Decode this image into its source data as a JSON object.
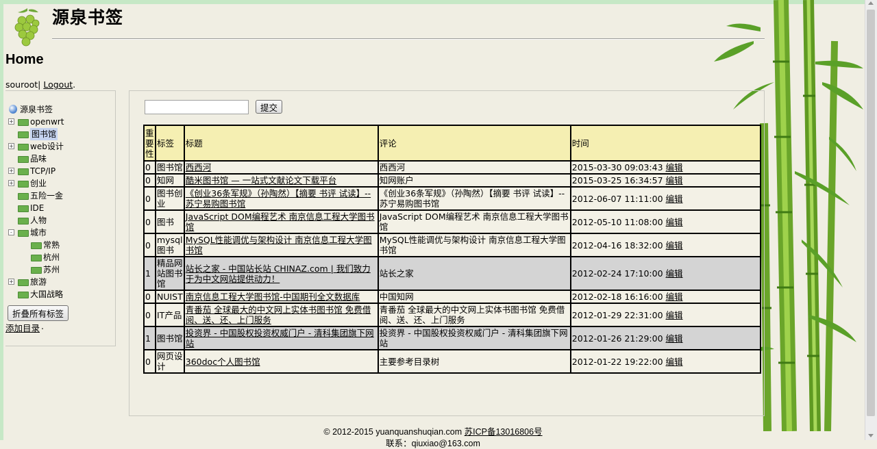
{
  "site": {
    "title": "源泉书签",
    "page_title": "Home"
  },
  "user": {
    "name": "souroot",
    "sep": "|",
    "logout_label": "Logout",
    "suffix": "."
  },
  "sidebar": {
    "root_label": "源泉书签",
    "items": [
      {
        "label": "openwrt",
        "toggle": "+"
      },
      {
        "label": "图书馆",
        "toggle": "",
        "selected": true
      },
      {
        "label": "web设计",
        "toggle": "+"
      },
      {
        "label": "品味",
        "toggle": ""
      },
      {
        "label": "TCP/IP",
        "toggle": "+"
      },
      {
        "label": "创业",
        "toggle": "+"
      },
      {
        "label": "五险一金",
        "toggle": ""
      },
      {
        "label": "IDE",
        "toggle": ""
      },
      {
        "label": "人物",
        "toggle": ""
      },
      {
        "label": "城市",
        "toggle": "-"
      },
      {
        "label": "常熟",
        "toggle": "",
        "child": true
      },
      {
        "label": "杭州",
        "toggle": "",
        "child": true
      },
      {
        "label": "苏州",
        "toggle": "",
        "child": true
      },
      {
        "label": "旅游",
        "toggle": "+"
      },
      {
        "label": "大国战略",
        "toggle": ""
      }
    ],
    "collapse_button": "折叠所有标签",
    "add_directory": "添加目录",
    "add_directory_suffix": "."
  },
  "search": {
    "placeholder": "",
    "value": "",
    "submit_label": "提交"
  },
  "table": {
    "headers": {
      "importance": "重要性",
      "tag": "标签",
      "title": "标题",
      "comment": "评论",
      "time": "时间"
    },
    "edit_label": "编辑",
    "rows": [
      {
        "importance": "0",
        "tag": "图书馆",
        "title": "西西河",
        "comment": "西西河",
        "time": "2015-03-30 09:03:43",
        "highlight": false
      },
      {
        "importance": "0",
        "tag": "知网",
        "title": "酷米图书馆 — 一站式文献论文下载平台",
        "comment": "知网账户",
        "time": "2015-03-25 16:34:57",
        "highlight": false
      },
      {
        "importance": "0",
        "tag": "图书创业",
        "title": "《创业36条军规》（孙陶然）【摘要 书评 试读】--苏宁易购图书馆",
        "comment": "《创业36条军规》（孙陶然）【摘要 书评 试读】--苏宁易购图书馆",
        "time": "2012-06-07 11:11:00",
        "highlight": false
      },
      {
        "importance": "0",
        "tag": "图书",
        "title": "JavaScript DOM编程艺术 南京信息工程大学图书馆",
        "comment": "JavaScript DOM编程艺术 南京信息工程大学图书馆",
        "time": "2012-05-10 11:08:00",
        "highlight": false
      },
      {
        "importance": "0",
        "tag": "mysql图书",
        "title": "MySQL性能调优与架构设计 南京信息工程大学图书馆",
        "comment": "MySQL性能调优与架构设计 南京信息工程大学图书馆",
        "time": "2012-04-16 18:32:00",
        "highlight": false
      },
      {
        "importance": "1",
        "tag": "精品网站图书馆",
        "title": "站长之家 - 中国站长站 CHINAZ.com | 我们致力于为中文网站提供动力！",
        "comment": "站长之家",
        "time": "2012-02-24 17:10:00",
        "highlight": true
      },
      {
        "importance": "0",
        "tag": "NUIST",
        "title": "南京信息工程大学图书馆-中国期刊全文数据库",
        "comment": "中国知网",
        "time": "2012-02-18 16:16:00",
        "highlight": false
      },
      {
        "importance": "0",
        "tag": "IT产品",
        "title": "青番茄 全球最大的中文网上实体书图书馆 免费借阅、送、还、上门服务",
        "comment": "青番茄 全球最大的中文网上实体书图书馆 免费借阅、送、还、上门服务",
        "time": "2012-01-29 22:31:00",
        "highlight": false
      },
      {
        "importance": "1",
        "tag": "图书馆",
        "title": "投资界 - 中国股权投资权威门户 - 清科集团旗下网站",
        "comment": "投资界 - 中国股权投资权威门户 - 清科集团旗下网站",
        "time": "2012-01-26 21:29:00",
        "highlight": true
      },
      {
        "importance": "0",
        "tag": "网页设计",
        "title": "360doc个人图书馆",
        "comment": "主要参考目录树",
        "time": "2012-01-22 19:22:00",
        "highlight": false
      }
    ]
  },
  "footer": {
    "copyright": "© 2012-2015 yuanquanshuqian.com",
    "icp": "苏ICP备13016806号",
    "contact": "联系：qiuxiao@163.com"
  }
}
